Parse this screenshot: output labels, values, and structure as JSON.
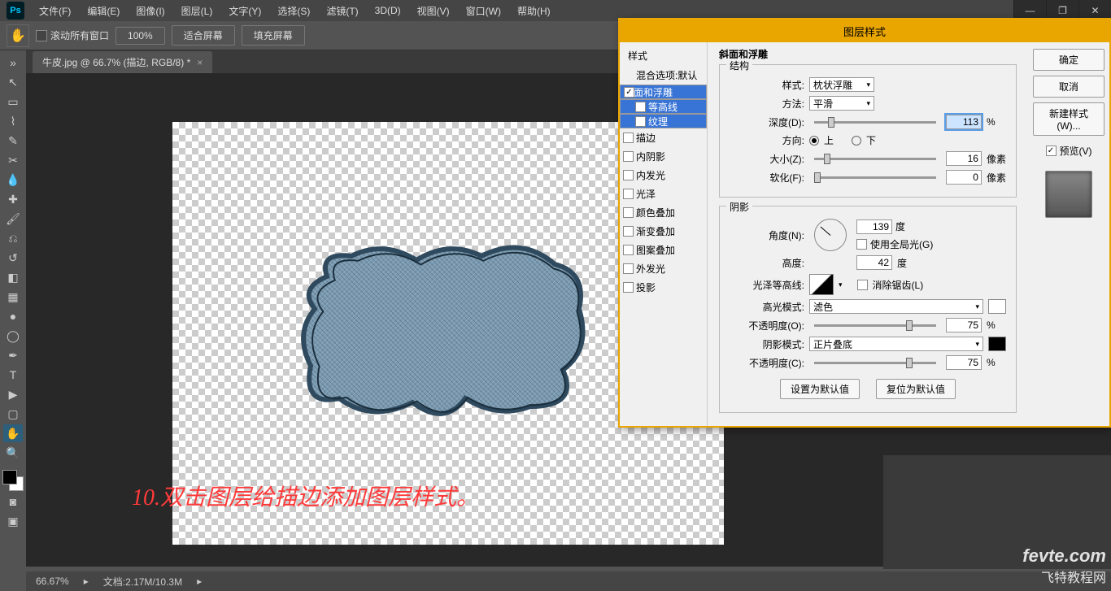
{
  "app": {
    "logo": "Ps"
  },
  "menu": {
    "file": "文件(F)",
    "edit": "编辑(E)",
    "image": "图像(I)",
    "layer": "图层(L)",
    "type": "文字(Y)",
    "select": "选择(S)",
    "filter": "滤镜(T)",
    "threeD": "3D(D)",
    "view": "视图(V)",
    "window": "窗口(W)",
    "help": "帮助(H)"
  },
  "options": {
    "scroll_all": "滚动所有窗口",
    "zoom": "100%",
    "fit": "适合屏幕",
    "fill": "填充屏幕"
  },
  "tab": {
    "title": "牛皮.jpg @ 66.7% (描边, RGB/8) *"
  },
  "annotation": "10.双击图层给描边添加图层样式。",
  "dialog": {
    "title": "图层样式",
    "ok": "确定",
    "cancel": "取消",
    "new_style": "新建样式(W)...",
    "preview": "预览(V)",
    "styles_header": "样式",
    "blend_default": "混合选项:默认",
    "styles": {
      "bevel": "斜面和浮雕",
      "contour": "等高线",
      "texture": "纹理",
      "stroke": "描边",
      "inner_shadow": "内阴影",
      "inner_glow": "内发光",
      "satin": "光泽",
      "color_overlay": "颜色叠加",
      "grad_overlay": "渐变叠加",
      "pattern_overlay": "图案叠加",
      "outer_glow": "外发光",
      "drop_shadow": "投影"
    },
    "section_bevel": "斜面和浮雕",
    "structure": "结构",
    "style_label": "样式:",
    "style_val": "枕状浮雕",
    "method_label": "方法:",
    "method_val": "平滑",
    "depth_label": "深度(D):",
    "depth_val": "113",
    "pct": "%",
    "dir_label": "方向:",
    "dir_up": "上",
    "dir_down": "下",
    "size_label": "大小(Z):",
    "size_val": "16",
    "px": "像素",
    "soften_label": "软化(F):",
    "soften_val": "0",
    "shadow": "阴影",
    "angle_label": "角度(N):",
    "angle_val": "139",
    "deg": "度",
    "global": "使用全局光(G)",
    "alt_label": "高度:",
    "alt_val": "42",
    "gloss_label": "光泽等高线:",
    "anti": "消除锯齿(L)",
    "hl_mode": "高光模式:",
    "hl_val": "滤色",
    "hl_opacity": "不透明度(O):",
    "hl_op_val": "75",
    "sh_mode": "阴影模式:",
    "sh_val": "正片叠底",
    "sh_opacity": "不透明度(C):",
    "sh_op_val": "75",
    "set_default": "设置为默认值",
    "reset_default": "复位为默认值"
  },
  "status": {
    "zoom": "66.67%",
    "doc": "文档:2.17M/10.3M"
  },
  "watermark": {
    "brand": "fevte.com",
    "sub": "飞特教程网"
  }
}
